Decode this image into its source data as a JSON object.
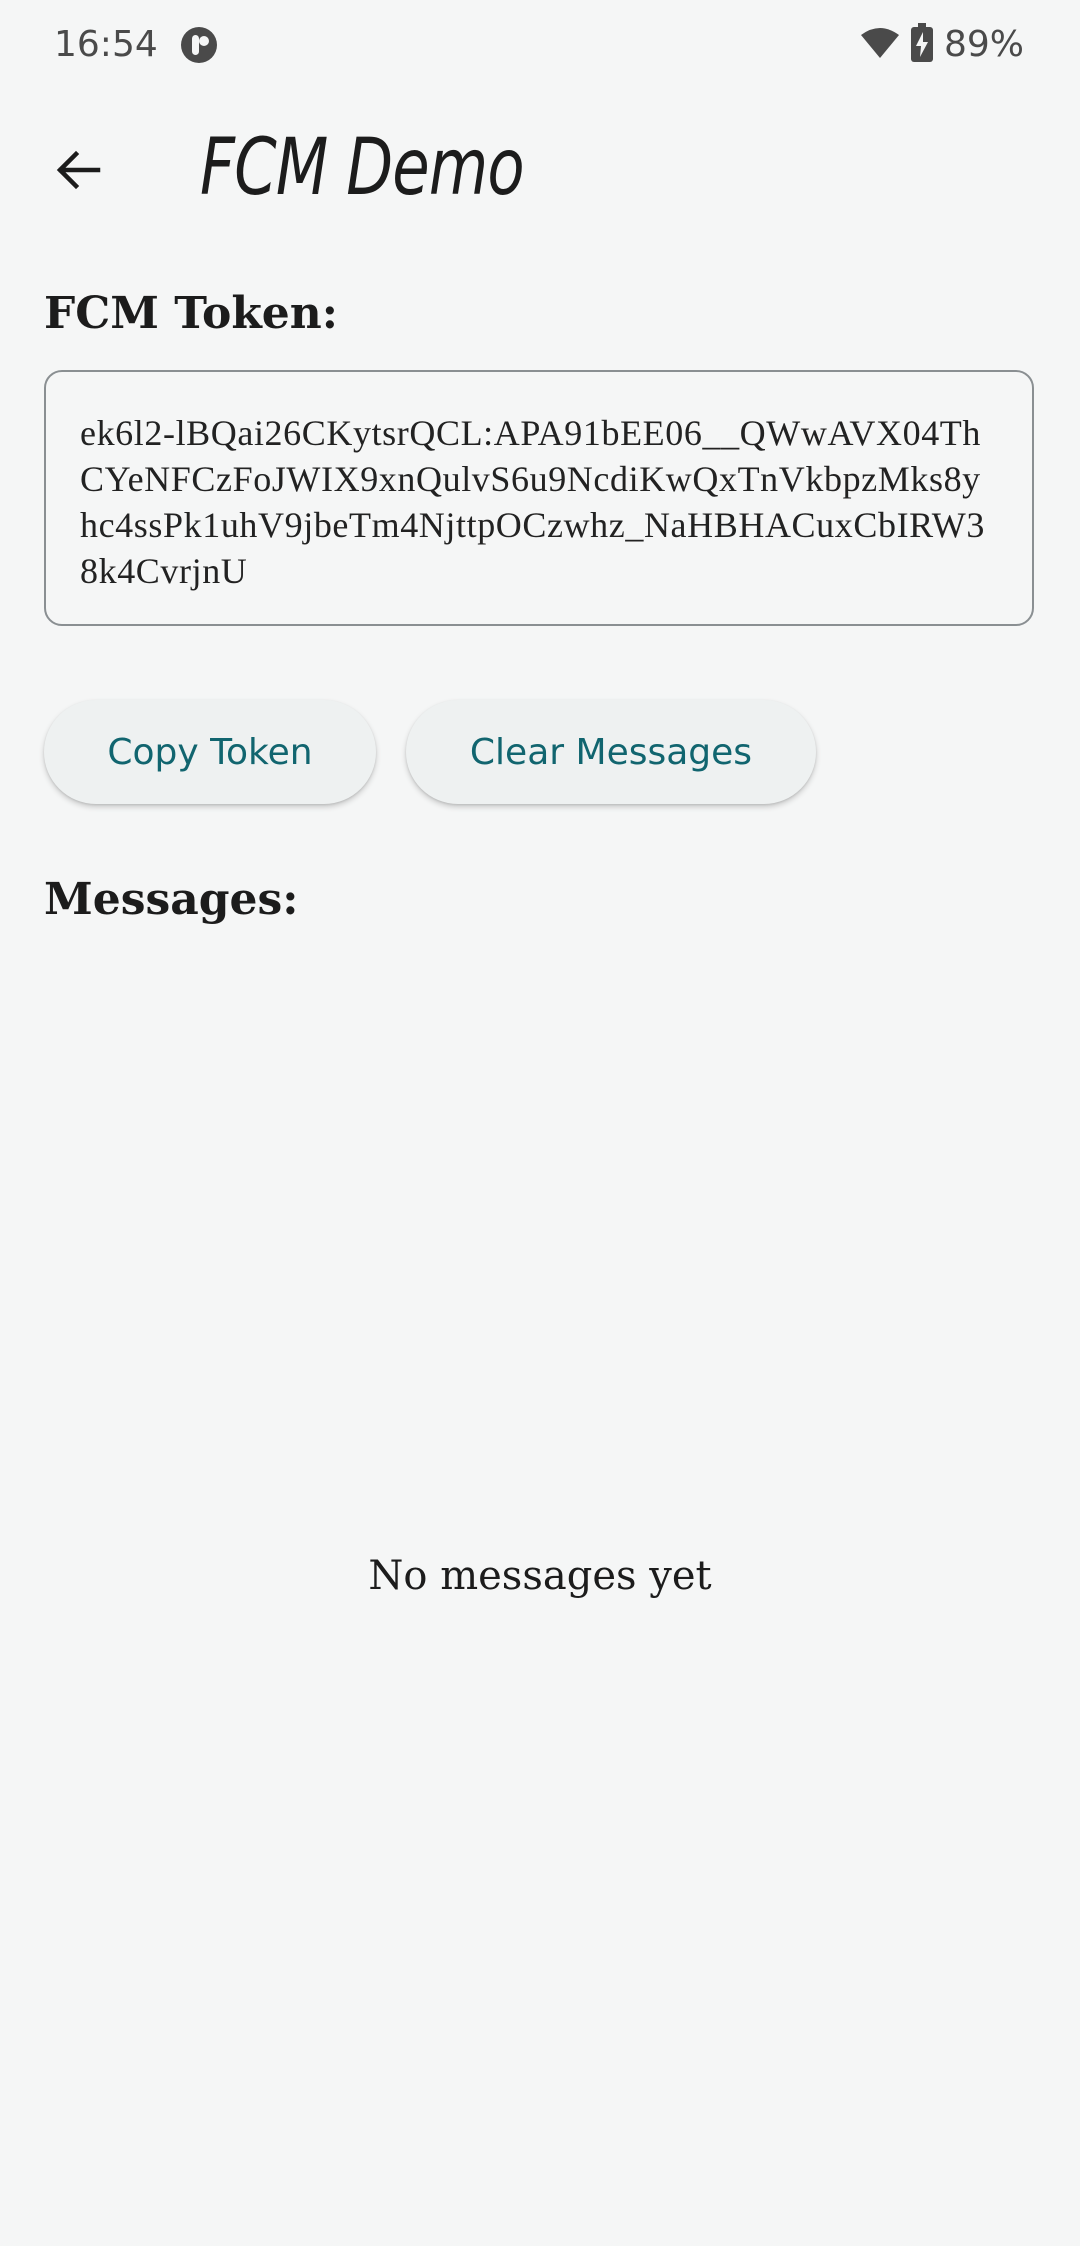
{
  "status_bar": {
    "time": "16:54",
    "battery": "89%",
    "icons": [
      "app-notification-icon",
      "wifi-icon",
      "battery-charging-icon"
    ]
  },
  "app_bar": {
    "title": "FCM Demo",
    "back_icon": "arrow-back-icon"
  },
  "token_section": {
    "label": "FCM Token:",
    "token": "ek6l2-lBQai26CKytsrQCL:APA91bEE06__QWwAVX04ThCYeNFCzFoJWIX9xnQulvS6u9NcdiKwQxTnVkbpzMks8yhc4ssPk1uhV9jbeTm4NjttpOCzwhz_NaHBHACuxCbIRW38k4CvrjnU"
  },
  "buttons": {
    "copy_token": "Copy Token",
    "clear_messages": "Clear Messages"
  },
  "messages_section": {
    "label": "Messages:",
    "empty_text": "No messages yet"
  },
  "colors": {
    "background": "#f5f6f6",
    "button_text": "#11656f",
    "button_background": "#eef1f1",
    "border": "#8a8f92"
  }
}
